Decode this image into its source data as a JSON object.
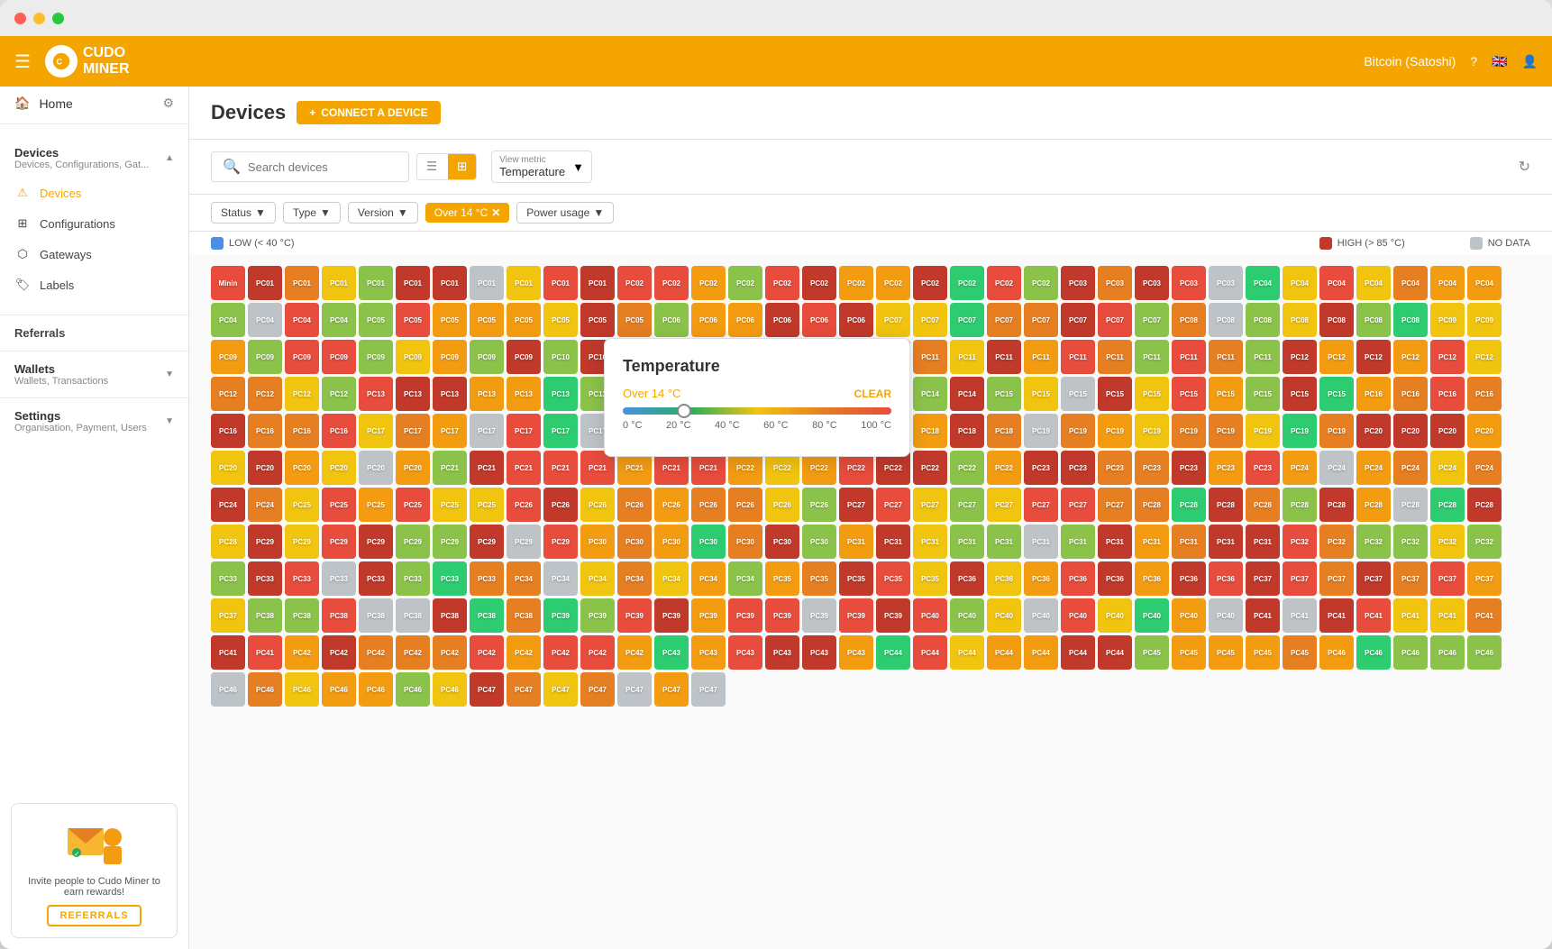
{
  "window": {
    "title": "Cudo Miner"
  },
  "topnav": {
    "logo_text": "CUDO\nMINER",
    "currency": "Bitcoin (Satoshi)"
  },
  "sidebar": {
    "home_label": "Home",
    "devices_section": {
      "title": "Devices",
      "subtitle": "Devices, Configurations, Gat...",
      "items": [
        {
          "id": "devices",
          "label": "Devices",
          "active": true
        },
        {
          "id": "configurations",
          "label": "Configurations",
          "active": false
        },
        {
          "id": "gateways",
          "label": "Gateways",
          "active": false
        },
        {
          "id": "labels",
          "label": "Labels",
          "active": false
        }
      ]
    },
    "referrals_label": "Referrals",
    "wallets_section": {
      "title": "Wallets",
      "subtitle": "Wallets, Transactions"
    },
    "settings_section": {
      "title": "Settings",
      "subtitle": "Organisation, Payment, Users"
    },
    "referral_banner": {
      "text": "Invite people to Cudo Miner to earn rewards!",
      "button_label": "REFERRALS"
    }
  },
  "content": {
    "page_title": "Devices",
    "connect_button": "CONNECT A DEVICE",
    "search_placeholder": "Search devices",
    "view_metric_label": "View metric",
    "view_metric_value": "Temperature",
    "filters": [
      {
        "id": "status",
        "label": "Status",
        "active": false
      },
      {
        "id": "type",
        "label": "Type",
        "active": false
      },
      {
        "id": "version",
        "label": "Version",
        "active": false
      },
      {
        "id": "temperature",
        "label": "Over 14 °C",
        "active": true
      },
      {
        "id": "power",
        "label": "Power usage",
        "active": false
      }
    ],
    "legend": {
      "low_label": "LOW (< 40 °C)",
      "high_label": "HIGH (> 85 °C)",
      "no_data_label": "NO DATA"
    }
  },
  "temperature_popup": {
    "title": "Temperature",
    "filter_label": "Over 14 °C",
    "clear_label": "CLEAR",
    "slider_labels": [
      "0 °C",
      "20 °C",
      "40 °C",
      "60 °C",
      "80 °C",
      "100 °C"
    ]
  },
  "device_grid": {
    "colors": {
      "low": "#27ae60",
      "med_low": "#8bc34a",
      "med": "#f1c40f",
      "med_high": "#f39c12",
      "high": "#e67e22",
      "very_high": "#e74c3c",
      "extreme": "#c0392b",
      "no_data": "#bdc3c7",
      "green_highlight": "#2ecc71"
    }
  }
}
